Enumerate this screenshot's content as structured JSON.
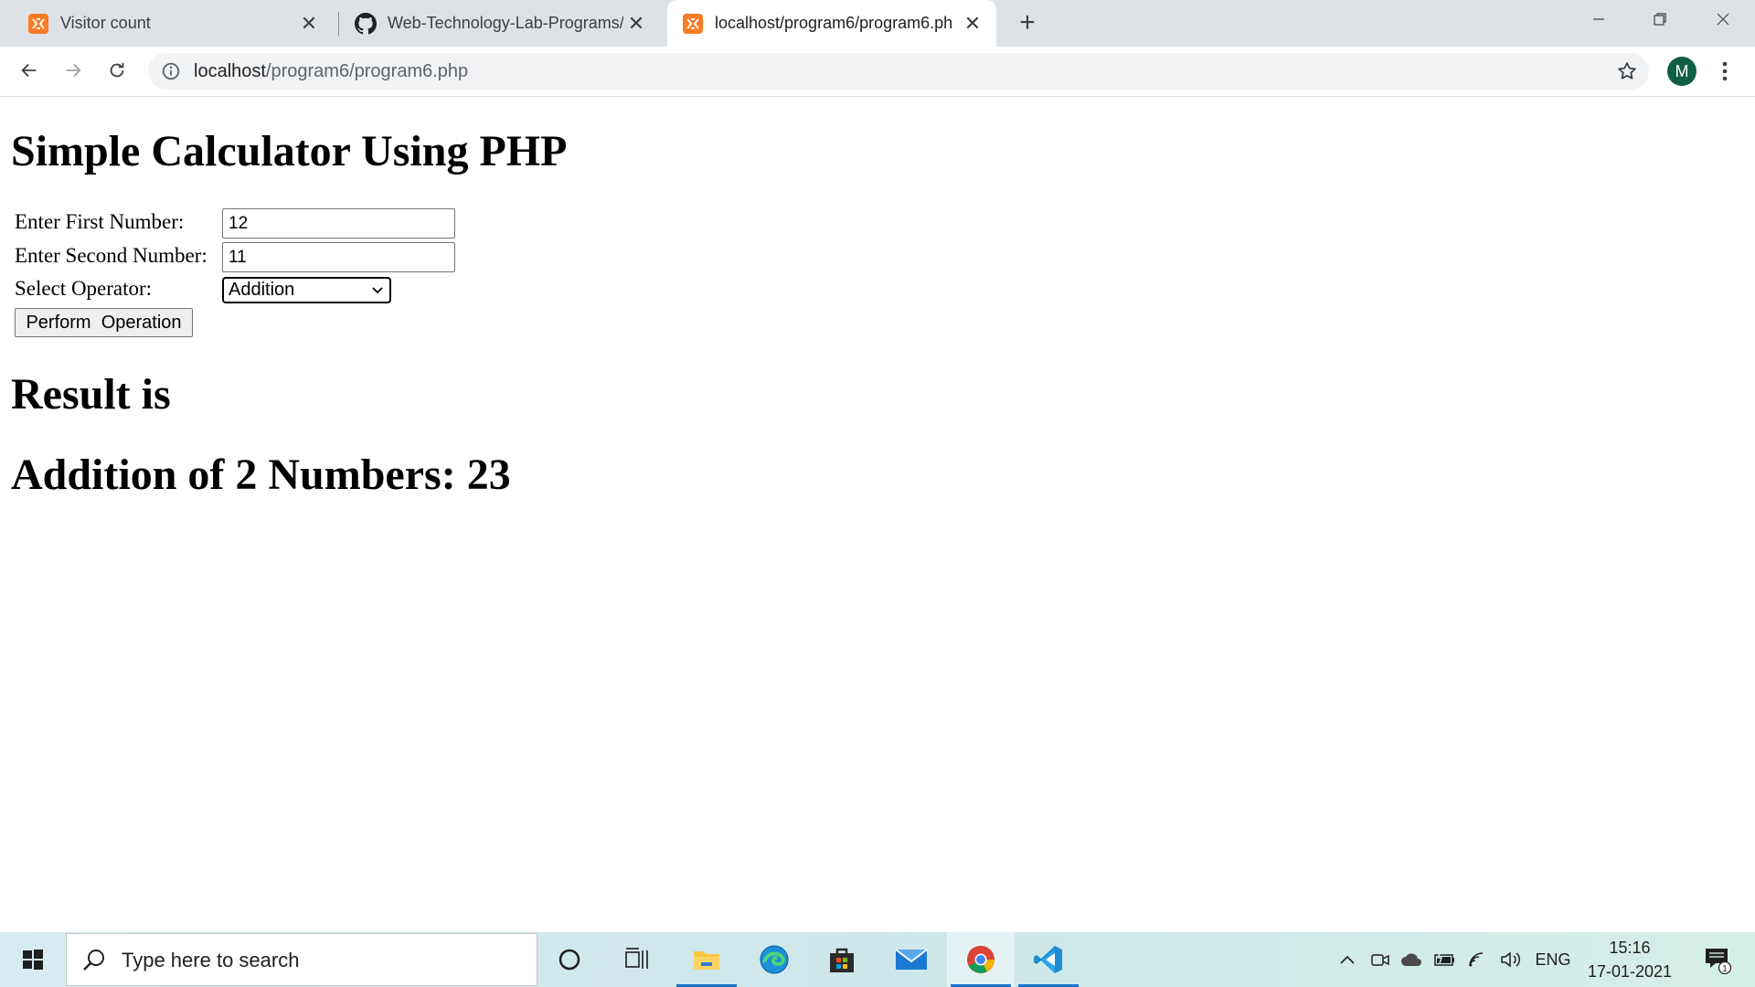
{
  "browser": {
    "tabs": [
      {
        "title": "Visitor count",
        "favicon": "xampp-icon",
        "active": false
      },
      {
        "title": "Web-Technology-Lab-Programs/",
        "favicon": "github-icon",
        "active": false
      },
      {
        "title": "localhost/program6/program6.ph",
        "favicon": "xampp-icon",
        "active": true
      }
    ],
    "new_tab_label": "+",
    "url_host": "localhost",
    "url_path": "/program6/program6.php",
    "profile_initial": "M",
    "accent_color": "#0f5f45"
  },
  "page": {
    "title": "Simple Calculator Using PHP",
    "form": {
      "first_label": "Enter First Number:",
      "first_value": "12",
      "second_label": "Enter Second Number:",
      "second_value": "11",
      "operator_label": "Select Operator:",
      "operator_selected": "Addition",
      "submit_label": "Perform  Operation"
    },
    "result_heading": "Result is",
    "result_text": "Addition of 2 Numbers: 23"
  },
  "taskbar": {
    "search_placeholder": "Type here to search",
    "language": "ENG",
    "time": "15:16",
    "date": "17-01-2021",
    "notification_count": "1"
  }
}
